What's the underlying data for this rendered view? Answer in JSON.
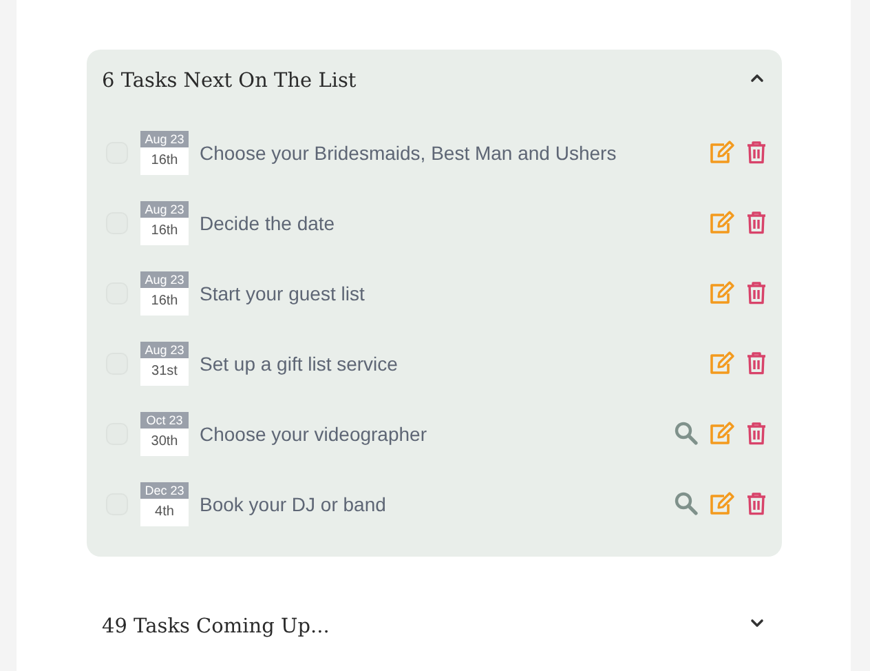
{
  "sections": [
    {
      "title": "6 Tasks Next On The List",
      "expanded": true,
      "tasks": [
        {
          "month": "Aug 23",
          "day": "16th",
          "text": "Choose your Bridesmaids, Best Man and Ushers",
          "checked": false,
          "search": false
        },
        {
          "month": "Aug 23",
          "day": "16th",
          "text": "Decide the date",
          "checked": false,
          "search": false
        },
        {
          "month": "Aug 23",
          "day": "16th",
          "text": "Start your guest list",
          "checked": false,
          "search": false
        },
        {
          "month": "Aug 23",
          "day": "31st",
          "text": "Set up a gift list service",
          "checked": false,
          "search": false
        },
        {
          "month": "Oct 23",
          "day": "30th",
          "text": "Choose your videographer",
          "checked": false,
          "search": true
        },
        {
          "month": "Dec 23",
          "day": "4th",
          "text": "Book your DJ or band",
          "checked": false,
          "search": true
        }
      ]
    },
    {
      "title": "49 Tasks Coming Up...",
      "expanded": false
    }
  ]
}
